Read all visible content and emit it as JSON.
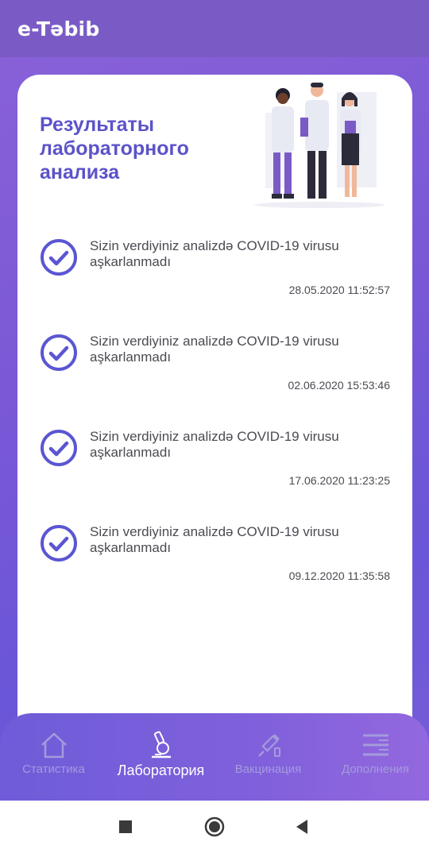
{
  "app_bar": {
    "title": "e-Təbib"
  },
  "card": {
    "title": "Результаты лабораторного анализа",
    "results": [
      {
        "text": "Sizin verdiyiniz analizdə COVID-19 virusu aşkarlanmadı",
        "date": "28.05.2020 11:52:57"
      },
      {
        "text": "Sizin verdiyiniz analizdə COVID-19 virusu aşkarlanmadı",
        "date": "02.06.2020 15:53:46"
      },
      {
        "text": "Sizin verdiyiniz analizdə COVID-19 virusu aşkarlanmadı",
        "date": "17.06.2020 11:23:25"
      },
      {
        "text": "Sizin verdiyiniz analizdə COVID-19 virusu aşkarlanmadı",
        "date": "09.12.2020 11:35:58"
      }
    ]
  },
  "bottom_nav": {
    "items": [
      {
        "label": "Статистика",
        "icon": "home-icon",
        "active": false
      },
      {
        "label": "Лаборатория",
        "icon": "microscope-icon",
        "active": true
      },
      {
        "label": "Вакцинация",
        "icon": "syringe-icon",
        "active": false
      },
      {
        "label": "Дополнения",
        "icon": "menu-icon",
        "active": false
      }
    ]
  },
  "system_nav": {
    "buttons": [
      "recent-apps-icon",
      "home-circle-icon",
      "back-icon"
    ]
  },
  "colors": {
    "accent": "#5b53c9",
    "check": "#5a56d2",
    "app_bar": "#7a5bc6"
  }
}
